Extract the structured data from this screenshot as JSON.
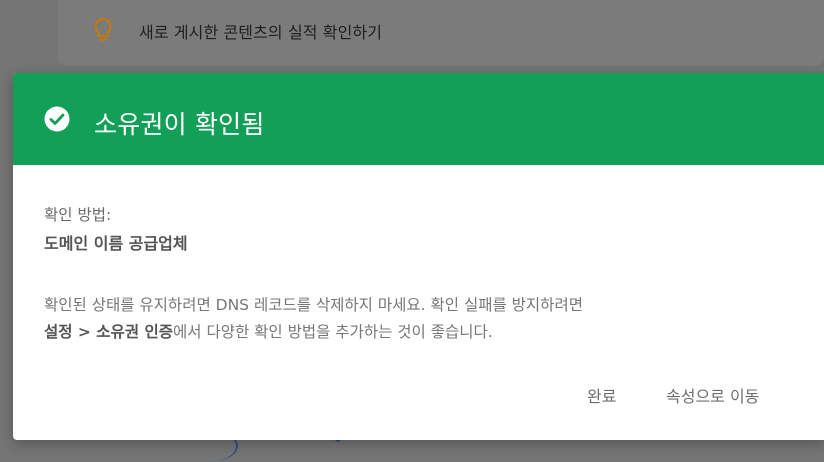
{
  "background": {
    "card_text": "새로 게시한 콘텐츠의 실적 확인하기",
    "card_icon": "lightbulb-icon"
  },
  "dialog": {
    "title": "소유권이 확인됨",
    "header_icon": "check-circle-icon",
    "header_color": "#129f58",
    "method_label": "확인 방법:",
    "method_value": "도메인 이름 공급업체",
    "description_line1": "확인된 상태를 유지하려면 DNS 레코드를 삭제하지 마세요. 확인 실패를 방지하려면",
    "description_link": "설정 > 소유권 인증",
    "description_line2": "에서 다양한 확인 방법을 추가하는 것이 좋습니다.",
    "buttons": {
      "done": "완료",
      "go_to_property": "속성으로 이동"
    }
  }
}
